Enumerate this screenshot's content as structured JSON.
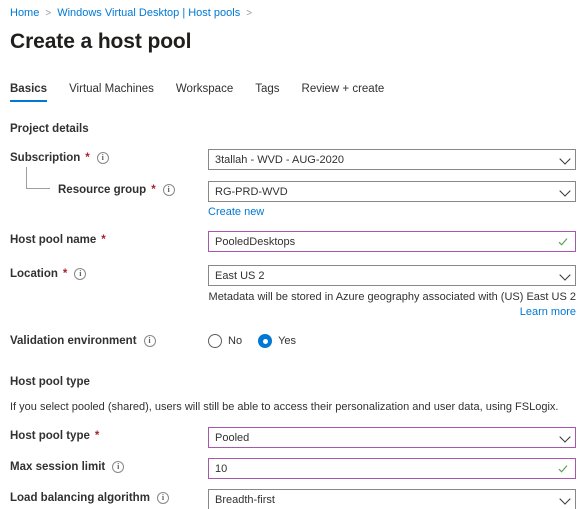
{
  "breadcrumb": {
    "items": [
      "Home",
      "Windows Virtual Desktop | Host pools"
    ],
    "separator": ">"
  },
  "page_title": "Create a host pool",
  "tabs": [
    {
      "label": "Basics",
      "active": true
    },
    {
      "label": "Virtual Machines",
      "active": false
    },
    {
      "label": "Workspace",
      "active": false
    },
    {
      "label": "Tags",
      "active": false
    },
    {
      "label": "Review + create",
      "active": false
    }
  ],
  "sections": {
    "project_details": {
      "heading": "Project details",
      "subscription": {
        "label": "Subscription",
        "required": "*",
        "value": "3tallah - WVD - AUG-2020"
      },
      "resource_group": {
        "label": "Resource group",
        "required": "*",
        "value": "RG-PRD-WVD",
        "create_new": "Create new"
      },
      "host_pool_name": {
        "label": "Host pool name",
        "required": "*",
        "value": "PooledDesktops"
      },
      "location": {
        "label": "Location",
        "required": "*",
        "value": "East US 2",
        "hint": "Metadata will be stored in Azure geography associated with (US) East US 2",
        "learn_more": "Learn more"
      },
      "validation_environment": {
        "label": "Validation environment",
        "options": [
          "No",
          "Yes"
        ],
        "selected": "Yes"
      }
    },
    "host_pool_type": {
      "heading": "Host pool type",
      "description": "If you select pooled (shared), users will still be able to access their personalization and user data, using FSLogix.",
      "type": {
        "label": "Host pool type",
        "required": "*",
        "value": "Pooled"
      },
      "max_session_limit": {
        "label": "Max session limit",
        "value": "10"
      },
      "load_balancing_algorithm": {
        "label": "Load balancing algorithm",
        "value": "Breadth-first"
      }
    }
  },
  "colors": {
    "accent": "#0078d4",
    "required": "#a4262c",
    "valid_border": "#a657ae",
    "valid_check": "#5aa454",
    "border": "#8a8886"
  }
}
